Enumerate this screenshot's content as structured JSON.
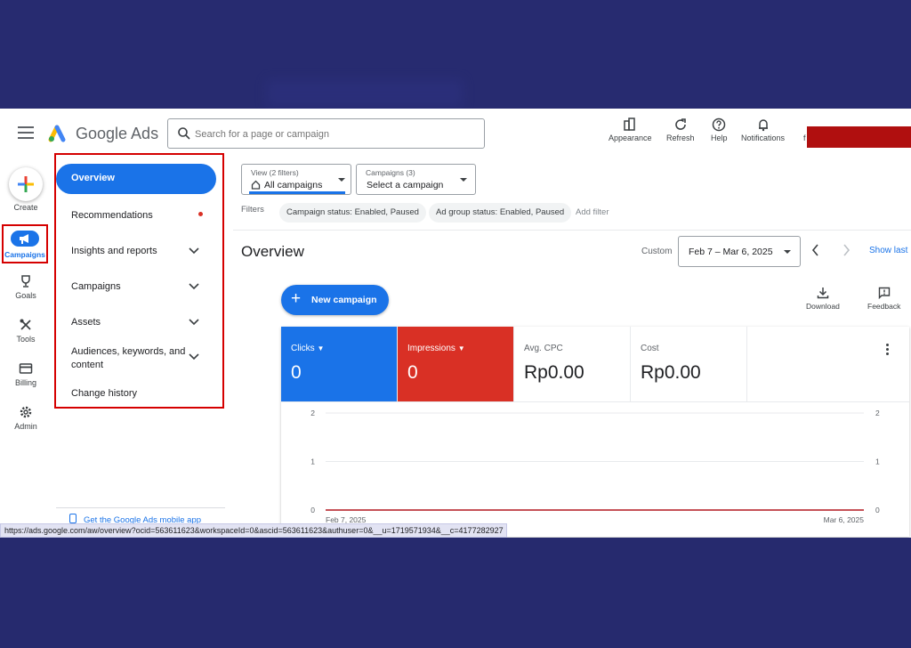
{
  "app": {
    "brand": "Google Ads"
  },
  "search": {
    "placeholder": "Search for a page or campaign"
  },
  "header_tools": [
    {
      "label": "Appearance",
      "icon": "appearance-icon"
    },
    {
      "label": "Refresh",
      "icon": "refresh-icon"
    },
    {
      "label": "Help",
      "icon": "help-icon"
    },
    {
      "label": "Notifications",
      "icon": "bell-icon"
    }
  ],
  "account": {
    "initial": "f"
  },
  "rail": {
    "create": "Create",
    "campaigns": "Campaigns",
    "goals": "Goals",
    "tools": "Tools",
    "billing": "Billing",
    "admin": "Admin"
  },
  "nav": {
    "overview": "Overview",
    "recommendations": "Recommendations",
    "insights": "Insights and reports",
    "campaigns": "Campaigns",
    "assets": "Assets",
    "audiences_line1": "Audiences, keywords, and",
    "audiences_line2": "content",
    "change_history": "Change history",
    "mobile_app": "Get the Google Ads mobile app"
  },
  "filters": {
    "view_small": "View (2 filters)",
    "view_main": "All campaigns",
    "campaigns_small": "Campaigns (3)",
    "campaigns_main": "Select a campaign",
    "label": "Filters",
    "chip1": "Campaign status: Enabled, Paused",
    "chip2": "Ad group status: Enabled, Paused",
    "add": "Add filter"
  },
  "overview": {
    "title": "Overview",
    "custom": "Custom",
    "date_range": "Feb 7 – Mar 6, 2025",
    "show_last": "Show last",
    "new_campaign": "New campaign",
    "download": "Download",
    "feedback": "Feedback"
  },
  "metrics": [
    {
      "label": "Clicks",
      "value": "0",
      "color": "#1a73e8"
    },
    {
      "label": "Impressions",
      "value": "0",
      "color": "#d93025"
    },
    {
      "label": "Avg. CPC",
      "value": "Rp0.00"
    },
    {
      "label": "Cost",
      "value": "Rp0.00"
    }
  ],
  "chart_data": {
    "type": "line",
    "x": [
      "Feb 7, 2025",
      "Mar 6, 2025"
    ],
    "xlabels": [
      "Feb 7, 2025",
      "Mar 6, 2025"
    ],
    "yticks": [
      0,
      1,
      2
    ],
    "ylim": [
      0,
      2
    ],
    "series": [
      {
        "name": "Clicks",
        "values": [
          0,
          0
        ],
        "color": "#1a73e8"
      },
      {
        "name": "Impressions",
        "values": [
          0,
          0
        ],
        "color": "#d93025"
      }
    ],
    "grid": true
  },
  "status_url": "https://ads.google.com/aw/overview?ocid=563611623&workspaceId=0&ascid=563611623&authuser=0&__u=1719571934&__c=4177282927"
}
